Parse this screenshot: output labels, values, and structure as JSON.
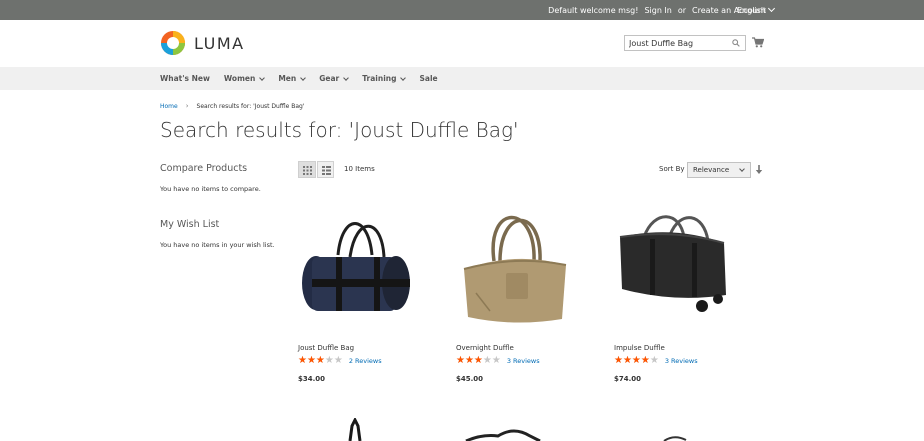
{
  "top_panel": {
    "welcome": "Default welcome msg!",
    "sign_in": "Sign In",
    "or": "or",
    "create_account": "Create an Account",
    "language": "English"
  },
  "header": {
    "logo_text": "LUMA",
    "search_value": "Joust Duffle Bag",
    "search_icon": "search-icon",
    "cart_icon": "cart-icon"
  },
  "nav": {
    "items": [
      {
        "label": "What's New",
        "has_dropdown": false
      },
      {
        "label": "Women",
        "has_dropdown": true
      },
      {
        "label": "Men",
        "has_dropdown": true
      },
      {
        "label": "Gear",
        "has_dropdown": true
      },
      {
        "label": "Training",
        "has_dropdown": true
      },
      {
        "label": "Sale",
        "has_dropdown": false
      }
    ]
  },
  "breadcrumb": {
    "home": "Home",
    "separator": "›",
    "current": "Search results for: 'Joust Duffle Bag'"
  },
  "page_title": "Search results for: 'Joust Duffle Bag'",
  "sidebar": {
    "compare_title": "Compare Products",
    "compare_text": "You have no items to compare.",
    "wishlist_title": "My Wish List",
    "wishlist_text": "You have no items in your wish list."
  },
  "toolbar": {
    "grid_icon": "grid-view-icon",
    "list_icon": "list-view-icon",
    "items_count": "10 Items",
    "sort_label": "Sort By",
    "sort_value": "Relevance",
    "sort_direction_icon": "arrow-down-icon"
  },
  "products": [
    {
      "name": "Joust Duffle Bag",
      "rating_percent": 60,
      "reviews": "2  Reviews",
      "price": "$34.00",
      "color": "#2b3550"
    },
    {
      "name": "Overnight Duffle",
      "rating_percent": 60,
      "reviews": "3  Reviews",
      "price": "$45.00",
      "color": "#b09a72"
    },
    {
      "name": "Impulse Duffle",
      "rating_percent": 80,
      "reviews": "3  Reviews",
      "price": "$74.00",
      "color": "#2a2a2a"
    }
  ],
  "colors": {
    "top_bar": "#6e716e",
    "nav_bg": "#f0f0f0",
    "link": "#006bb4",
    "star": "#ff5501"
  }
}
